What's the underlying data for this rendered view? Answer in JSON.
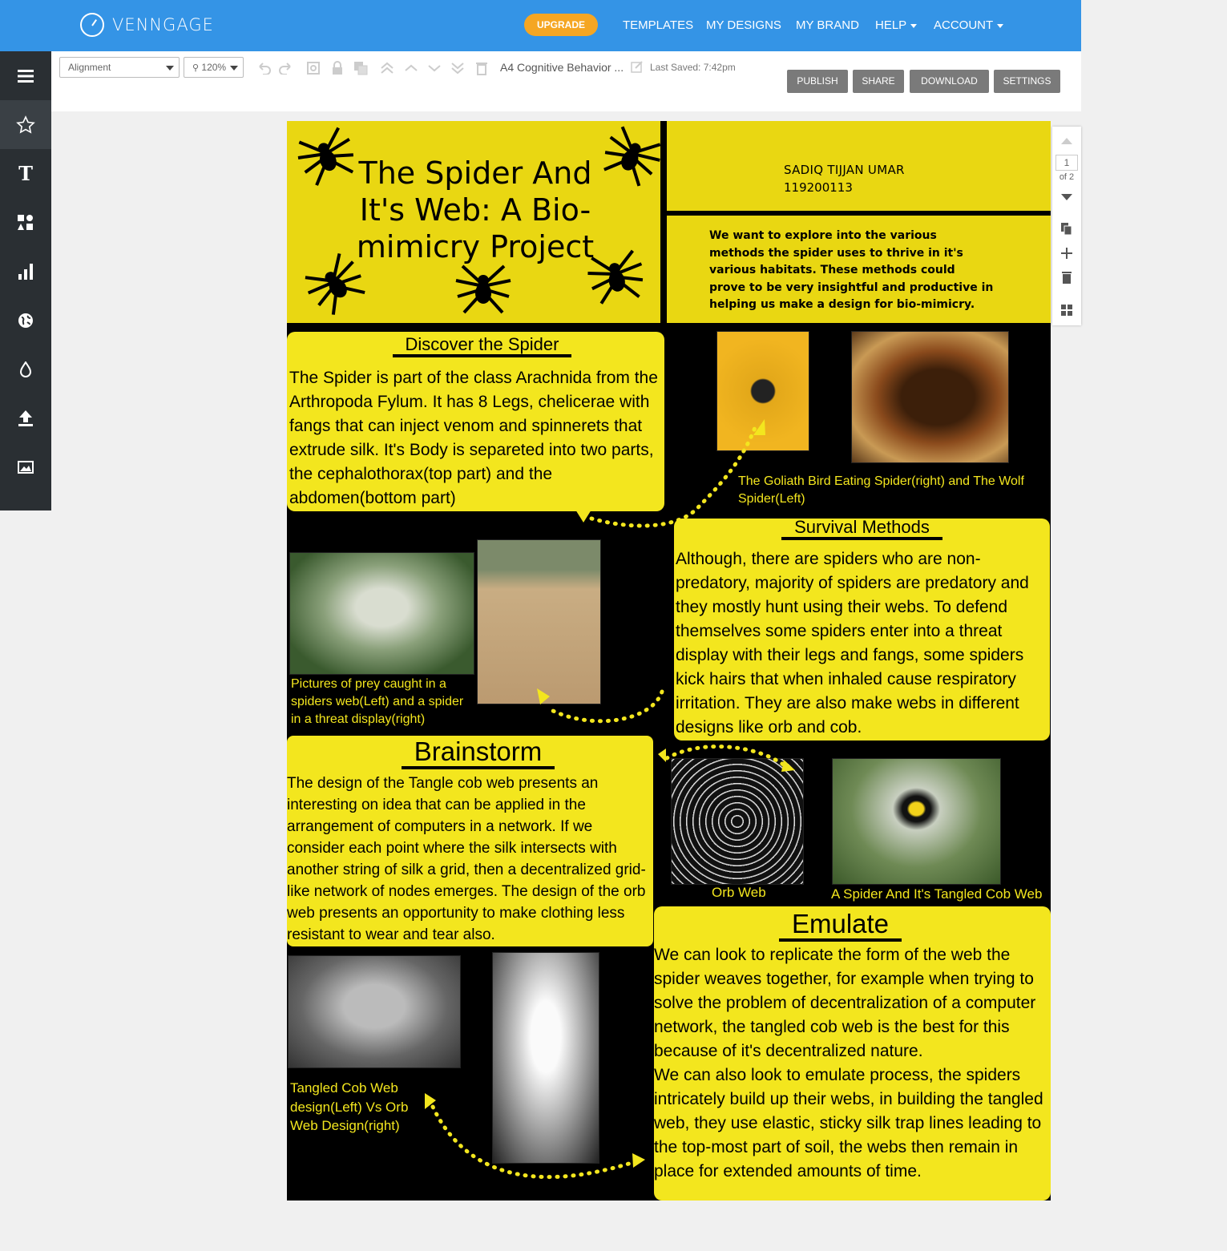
{
  "app": {
    "brand": "VENNGAGE",
    "upgrade_label": "UPGRADE",
    "nav": [
      "TEMPLATES",
      "MY DESIGNS",
      "MY BRAND",
      "HELP",
      "ACCOUNT"
    ]
  },
  "toolbar": {
    "alignment_label": "Alignment",
    "zoom_label": "120%",
    "doc_title": "A4 Cognitive Behavior ...",
    "last_saved": "Last Saved: 7:42pm",
    "publish_label": "PUBLISH",
    "share_label": "SHARE",
    "download_label": "DOWNLOAD",
    "settings_label": "SETTINGS"
  },
  "sidebar": {
    "items": [
      "menu-icon",
      "star-icon",
      "text-icon",
      "shapes-icon",
      "chart-icon",
      "globe-icon",
      "drop-icon",
      "upload-icon",
      "image-icon",
      "shuffle-icon"
    ]
  },
  "pager": {
    "current": "1",
    "of_label": "of 2"
  },
  "poster": {
    "title": "The Spider And It's Web: A Bio-mimicry Project",
    "author_name": "SADIQ TIJJAN UMAR",
    "author_id": "119200113",
    "intro": "We want to explore into the various methods the spider uses to thrive in it's various habitats. These methods could prove to be very insightful and productive in helping us make a design for bio-mimicry.",
    "discover_heading": "Discover the Spider",
    "discover_text": "The Spider is part of the class Arachnida from the Arthropoda Fylum. It has 8 Legs, chelicerae with fangs that can inject venom and spinnerets that extrude silk. It's Body is separeted into two parts, the cephalothorax(top part) and the abdomen(bottom part)",
    "caption_goliath": "The Goliath Bird Eating Spider(right) and The Wolf Spider(Left)",
    "survival_heading": "Survival Methods",
    "survival_text": "Although, there are spiders who are non-predatory, majority of spiders are predatory and they mostly hunt using their webs. To defend themselves some spiders enter into a threat display with their legs and fangs, some spiders kick hairs that when inhaled cause respiratory irritation. They are also make webs in different designs like orb and cob.",
    "caption_prey": "Pictures of prey caught in a spiders web(Left) and a spider in a threat display(right)",
    "brainstorm_heading": "Brainstorm",
    "brainstorm_text": "The design of the Tangle cob web presents an interesting on idea that can be applied in the arrangement of computers in a network. If we consider each point where the silk intersects with another string of silk a grid, then a decentralized grid-like network of nodes emerges. The design of the orb web presents an opportunity to make clothing less resistant to wear and tear also.",
    "caption_orb": "Orb Web",
    "caption_tangled": "A Spider And It's Tangled Cob Web",
    "emulate_heading": "Emulate",
    "emulate_text_1": "We can look to replicate the form of the web the spider weaves together, for example when trying to solve the problem of decentralization of a computer network, the tangled cob web is the best for this because of it's decentralized nature.",
    "emulate_text_2": "We can also look to emulate process, the spiders intricately build up their webs, in building the tangled web, they use elastic, sticky silk trap lines leading  to the top-most part of soil, the webs then remain in place for extended amounts of time.",
    "caption_compare": "Tangled Cob Web design(Left) Vs Orb Web Design(right)"
  },
  "colors": {
    "topbar": "#3494e6",
    "upgrade": "#f5a623",
    "sidebar": "#2a2f33",
    "poster_yellow": "#f3e61e",
    "poster_black": "#000000"
  }
}
